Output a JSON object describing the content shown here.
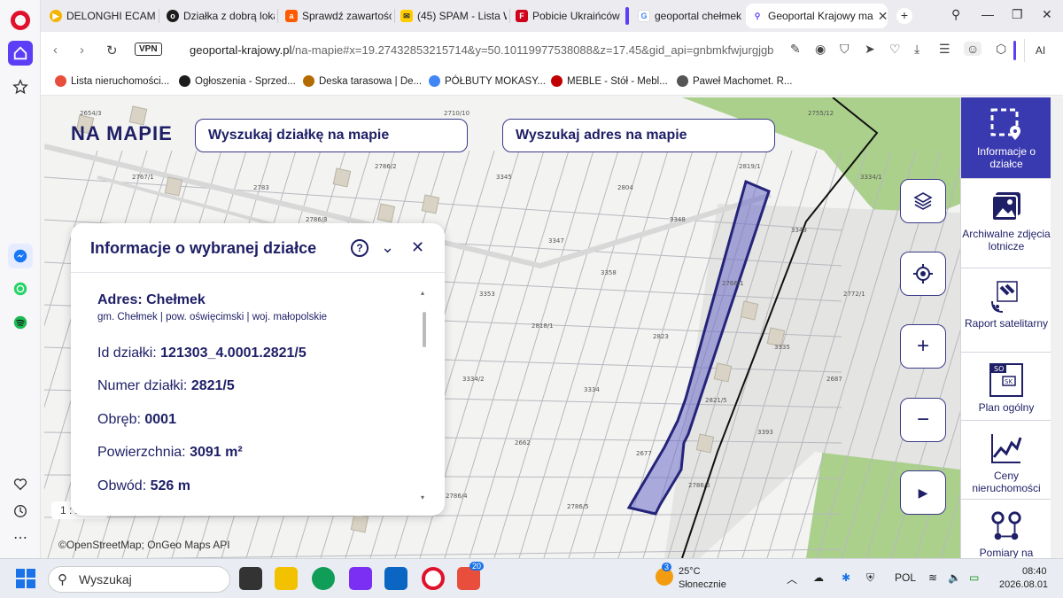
{
  "browser": {
    "tabs": [
      {
        "label": "DELONGHI ECAM47(",
        "favicon_color": "#f4b400"
      },
      {
        "label": "Działka z dobrą lokal",
        "favicon_color": "#1c1c1c"
      },
      {
        "label": "Sprawdź zawartość",
        "favicon_color": "#ff5a00"
      },
      {
        "label": "(45) SPAM - Lista W",
        "favicon_color": "#ffcc00"
      },
      {
        "label": "Pobicie Ukraińców w",
        "favicon_color": "#d0021b"
      },
      {
        "label": "geoportal chełmek",
        "favicon_color": "#4285f4"
      },
      {
        "label": "Geoportal Krajowy ma",
        "favicon_color": "#5b3ef5"
      }
    ],
    "vpn_label": "VPN",
    "url_domain": "geoportal-krajowy.pl",
    "url_path": "/na-mapie#x=19.27432853215714&y=50.10119977538088&z=17.45&gid_api=gnbmkfwjurgjgbhjrh",
    "ai_label": "AI",
    "bookmarks": [
      {
        "label": "Lista nieruchomości...",
        "color": "#e94e3c"
      },
      {
        "label": "Ogłoszenia - Sprzed...",
        "color": "#1c1c1c"
      },
      {
        "label": "Deska tarasowa | De...",
        "color": "#b36b00"
      },
      {
        "label": "PÓŁBUTY MOKASY...",
        "color": "#4285f4"
      },
      {
        "label": "MEBLE - Stół - Mebl...",
        "color": "#c00000"
      },
      {
        "label": "Paweł Machomet. R...",
        "color": "#555555"
      }
    ]
  },
  "map": {
    "logo_text": "NA MAPIE",
    "search_parcel": "Wyszukaj działkę na mapie",
    "search_address": "Wyszukaj adres na mapie",
    "scale_label": "1 : 2000",
    "copyright": "©OpenStreetMap; OnGeo Maps API",
    "parcel_labels": [
      "2654/3",
      "2657/1",
      "2682/10",
      "2710/10",
      "2710/5",
      "2710/11",
      "2755/12",
      "2767/1",
      "2783",
      "2786/2",
      "3345",
      "2804",
      "2819/1",
      "3334/1",
      "2831/1",
      "2786/3",
      "3346",
      "3347",
      "3348",
      "3349",
      "3350",
      "3351",
      "3352",
      "3353",
      "3358",
      "2766/1",
      "2772/1",
      "2764/3",
      "2789/2",
      "2805",
      "2818/1",
      "2823",
      "3335",
      "1204",
      "1263/2",
      "1209/13",
      "3334/2",
      "3334",
      "2821/5",
      "2687",
      "2685/1",
      "2665/5",
      "2665/3",
      "2662",
      "2677",
      "3393",
      "3358",
      "2707/1",
      "2789/5",
      "2786/4",
      "2786/5",
      "2786/6"
    ]
  },
  "info_panel": {
    "title": "Informacje o wybranej działce",
    "help_label": "?",
    "address_title": "Adres: Chełmek",
    "address_sub": "gm. Chełmek | pow. oświęcimski | woj. małopolskie",
    "fields": [
      {
        "label": "Id działki:",
        "value": "121303_4.0001.2821/5"
      },
      {
        "label": "Numer działki:",
        "value": "2821/5"
      },
      {
        "label": "Obręb:",
        "value": "0001"
      },
      {
        "label": "Powierzchnia:",
        "value": "3091 m²"
      },
      {
        "label": "Obwód:",
        "value": "526 m"
      }
    ]
  },
  "right_tools": [
    {
      "label": "Informacje o działce",
      "icon": "parcel-info-icon",
      "active": true
    },
    {
      "label": "Archiwalne zdjęcia lotnicze",
      "icon": "aerial-photos-icon",
      "active": false
    },
    {
      "label": "Raport satelitarny",
      "icon": "satellite-icon",
      "active": false
    },
    {
      "label": "Plan ogólny",
      "icon": "general-plan-icon",
      "active": false
    },
    {
      "label": "Ceny nieruchomości",
      "icon": "price-chart-icon",
      "active": false
    },
    {
      "label": "Pomiary na",
      "icon": "measurement-icon",
      "active": false
    }
  ],
  "taskbar": {
    "search_placeholder": "Wyszukaj",
    "badge_count": "20",
    "weather_badge": "3",
    "weather_temp": "25°C",
    "weather_desc": "Słonecznie",
    "language": "POL",
    "time": "08:40",
    "date": "2026.08.01"
  },
  "colors": {
    "accent": "#1e1f66",
    "opera_red": "#e0112b",
    "opera_purple": "#5b3ef5",
    "parcel_fill": "#6b6bc9",
    "green_area": "#9cc97a"
  }
}
